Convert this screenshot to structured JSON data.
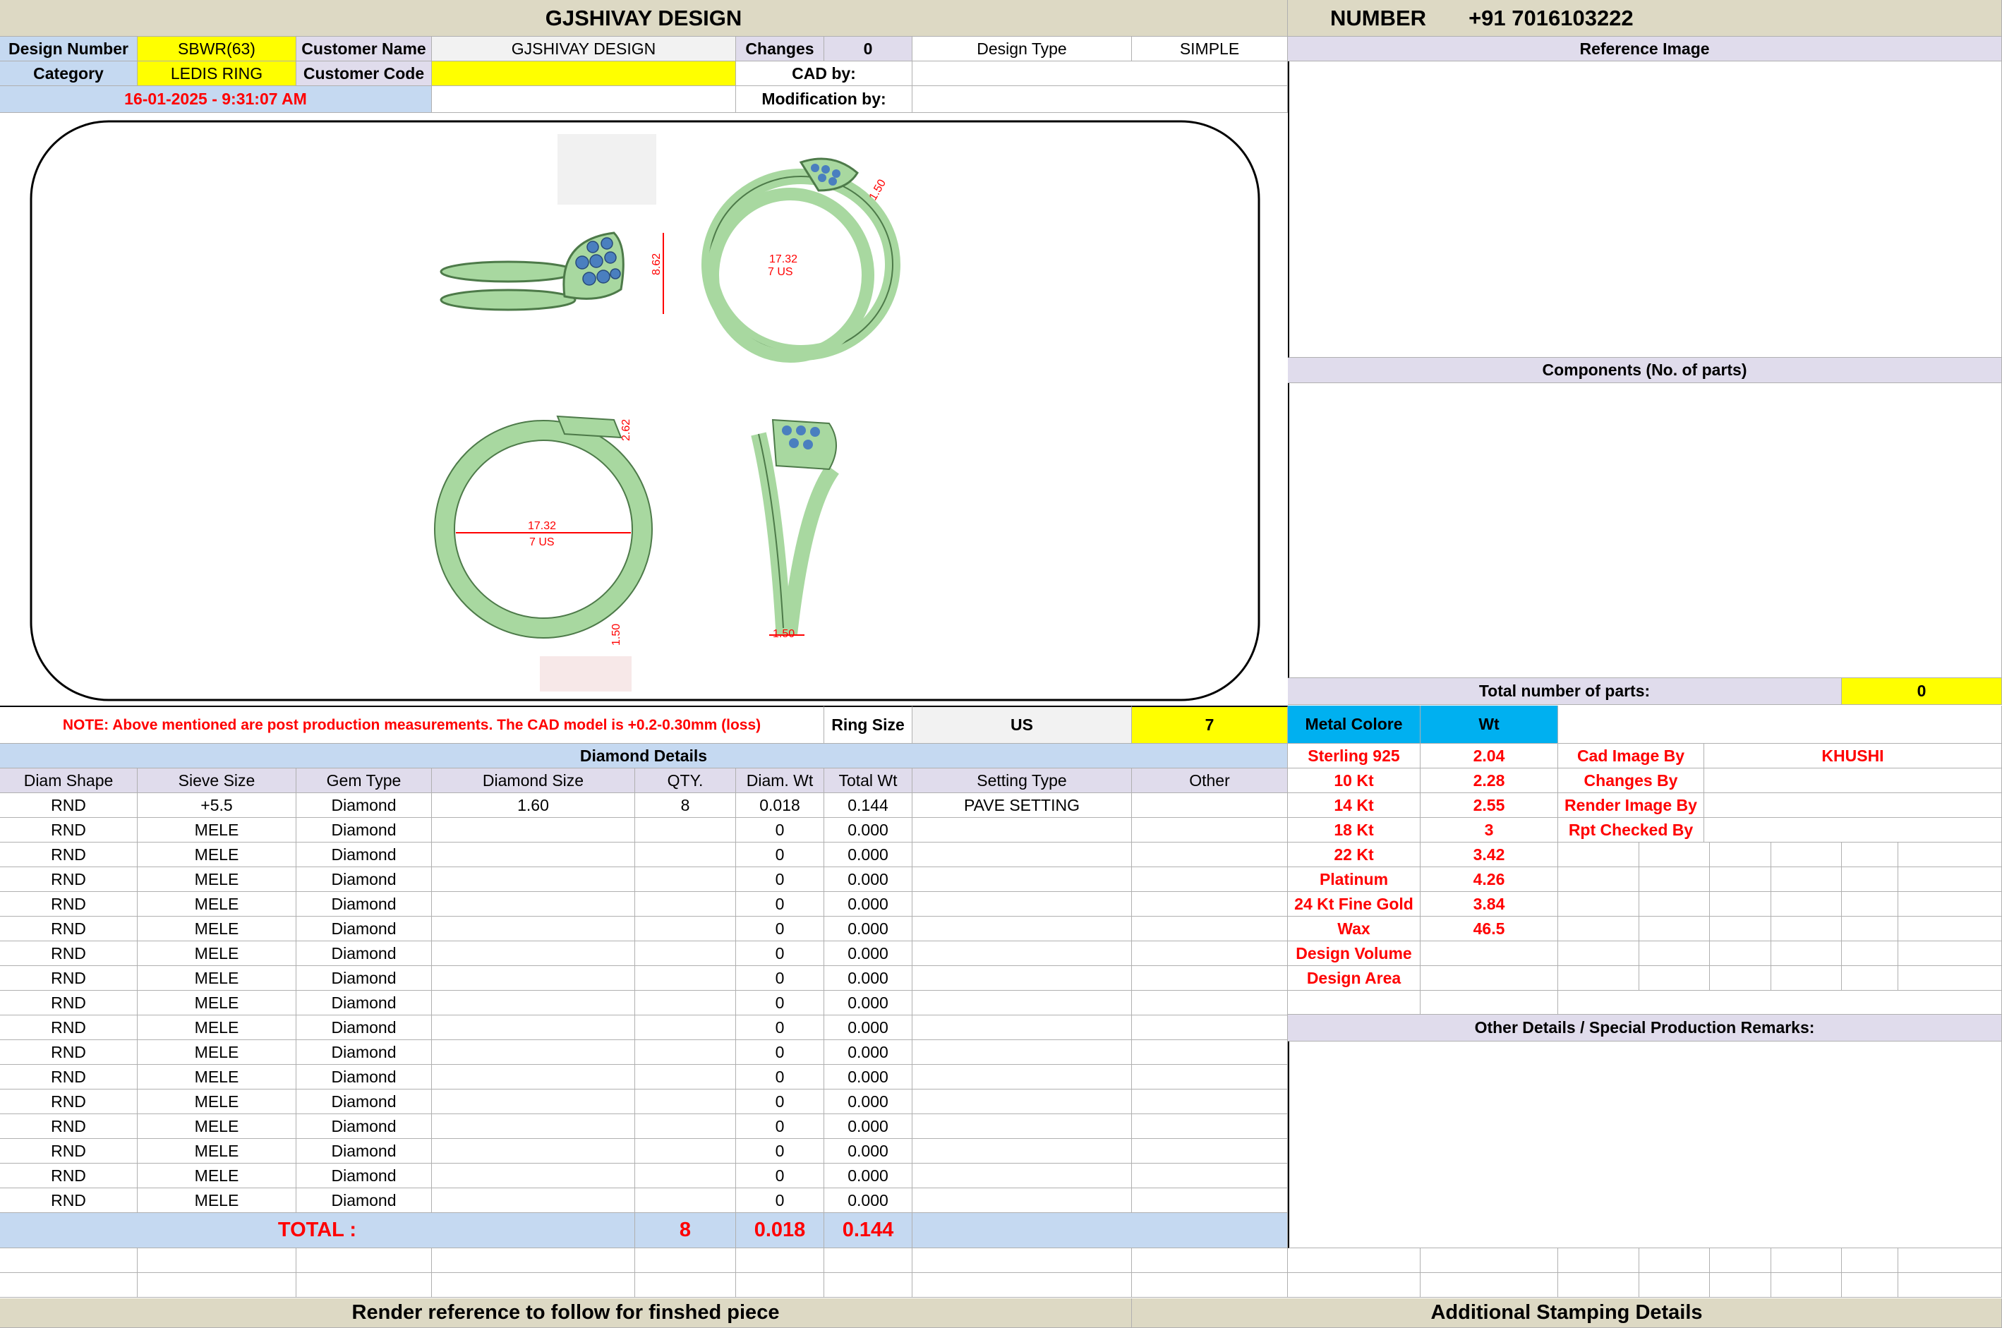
{
  "title": "GJSHIVAY DESIGN",
  "number_label": "NUMBER",
  "number_value": "+91 7016103222",
  "design_number_label": "Design Number",
  "design_number": "SBWR(63)",
  "customer_name_label": "Customer Name",
  "customer_name": "GJSHIVAY DESIGN",
  "changes_label": "Changes",
  "changes_value": "0",
  "design_type_label": "Design Type",
  "design_type": "SIMPLE",
  "category_label": "Category",
  "category": "LEDIS RING",
  "customer_code_label": "Customer Code",
  "customer_code": "",
  "cad_by_label": "CAD by:",
  "cad_by": "",
  "date": "16-01-2025 - 9:31:07 AM",
  "modification_by_label": "Modification by:",
  "modification_by": "",
  "reference_image_label": "Reference Image",
  "components_label": "Components (No. of parts)",
  "total_parts_label": "Total number of parts:",
  "total_parts": "0",
  "drawing": {
    "dim_height": "8.62",
    "dim_diameter": "17.32",
    "dim_size_us": "7 US",
    "dim_band": "1.50",
    "dim_top": "2.62",
    "dim_side": "1.50",
    "dim_small": "1.50"
  },
  "note": "NOTE: Above mentioned are post production measurements. The CAD model is +0.2-0.30mm (loss)",
  "ring_size_label": "Ring Size",
  "ring_size_unit": "US",
  "ring_size": "7",
  "metal_colore_label": "Metal Colore",
  "wt_label": "Wt",
  "diamond_details_label": "Diamond Details",
  "diamond_headers": [
    "Diam Shape",
    "Sieve Size",
    "Gem Type",
    "Diamond Size",
    "QTY.",
    "Diam. Wt",
    "Total Wt",
    "Setting Type",
    "Other"
  ],
  "diamond_rows": [
    [
      "RND",
      "+5.5",
      "Diamond",
      "1.60",
      "8",
      "0.018",
      "0.144",
      "PAVE SETTING",
      ""
    ],
    [
      "RND",
      "MELE",
      "Diamond",
      "",
      "",
      "0",
      "0.000",
      "",
      ""
    ],
    [
      "RND",
      "MELE",
      "Diamond",
      "",
      "",
      "0",
      "0.000",
      "",
      ""
    ],
    [
      "RND",
      "MELE",
      "Diamond",
      "",
      "",
      "0",
      "0.000",
      "",
      ""
    ],
    [
      "RND",
      "MELE",
      "Diamond",
      "",
      "",
      "0",
      "0.000",
      "",
      ""
    ],
    [
      "RND",
      "MELE",
      "Diamond",
      "",
      "",
      "0",
      "0.000",
      "",
      ""
    ],
    [
      "RND",
      "MELE",
      "Diamond",
      "",
      "",
      "0",
      "0.000",
      "",
      ""
    ],
    [
      "RND",
      "MELE",
      "Diamond",
      "",
      "",
      "0",
      "0.000",
      "",
      ""
    ],
    [
      "RND",
      "MELE",
      "Diamond",
      "",
      "",
      "0",
      "0.000",
      "",
      ""
    ],
    [
      "RND",
      "MELE",
      "Diamond",
      "",
      "",
      "0",
      "0.000",
      "",
      ""
    ],
    [
      "RND",
      "MELE",
      "Diamond",
      "",
      "",
      "0",
      "0.000",
      "",
      ""
    ],
    [
      "RND",
      "MELE",
      "Diamond",
      "",
      "",
      "0",
      "0.000",
      "",
      ""
    ],
    [
      "RND",
      "MELE",
      "Diamond",
      "",
      "",
      "0",
      "0.000",
      "",
      ""
    ],
    [
      "RND",
      "MELE",
      "Diamond",
      "",
      "",
      "0",
      "0.000",
      "",
      ""
    ],
    [
      "RND",
      "MELE",
      "Diamond",
      "",
      "",
      "0",
      "0.000",
      "",
      ""
    ],
    [
      "RND",
      "MELE",
      "Diamond",
      "",
      "",
      "0",
      "0.000",
      "",
      ""
    ],
    [
      "RND",
      "MELE",
      "Diamond",
      "",
      "",
      "0",
      "0.000",
      "",
      ""
    ]
  ],
  "total_label": "TOTAL :",
  "total_qty": "8",
  "total_diam_wt": "0.018",
  "total_wt": "0.144",
  "metals": [
    {
      "name": "Sterling 925",
      "wt": "2.04"
    },
    {
      "name": "10 Kt",
      "wt": "2.28"
    },
    {
      "name": "14 Kt",
      "wt": "2.55"
    },
    {
      "name": "18 Kt",
      "wt": "3"
    },
    {
      "name": "22 Kt",
      "wt": "3.42"
    },
    {
      "name": "Platinum",
      "wt": "4.26"
    },
    {
      "name": "24 Kt Fine Gold",
      "wt": "3.84"
    },
    {
      "name": "Wax",
      "wt": "46.5"
    },
    {
      "name": "Design Volume",
      "wt": ""
    },
    {
      "name": "Design Area",
      "wt": ""
    }
  ],
  "credits": [
    {
      "label": "Cad Image By",
      "value": "KHUSHI"
    },
    {
      "label": "Changes By",
      "value": ""
    },
    {
      "label": "Render Image By",
      "value": ""
    },
    {
      "label": "Rpt Checked By",
      "value": ""
    }
  ],
  "other_details_label": "Other Details / Special Production Remarks:",
  "render_reference_label": "Render reference to follow for finshed piece",
  "stamping_label": "Additional Stamping Details",
  "colors": {
    "ring_green": "#a8d8a0",
    "gem_blue": "#4a7fbf",
    "dim_red": "#ff0000"
  }
}
